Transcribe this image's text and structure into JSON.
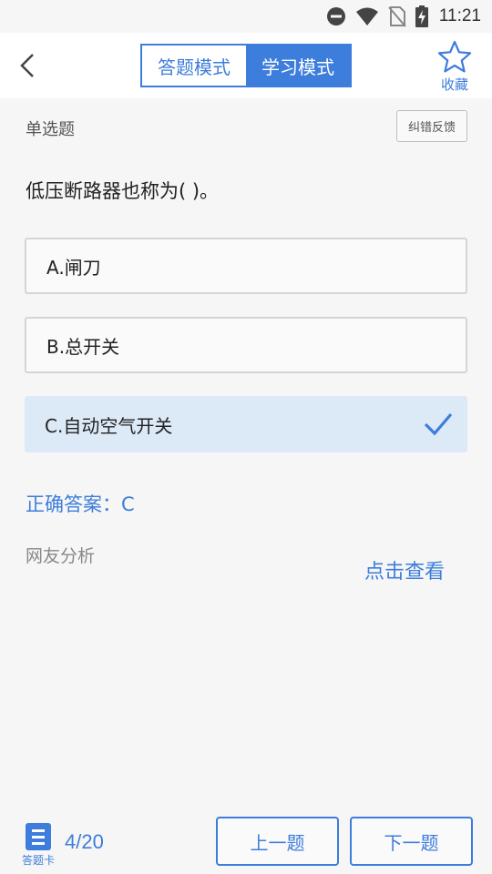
{
  "status_bar": {
    "time": "11:21",
    "icons": [
      "do-not-disturb-icon",
      "wifi-icon",
      "no-sim-icon",
      "battery-charging-icon"
    ]
  },
  "header": {
    "modes": [
      "答题模式",
      "学习模式"
    ],
    "active_mode": "学习模式",
    "favorite_label": "收藏",
    "accent_color": "#3d7ddb"
  },
  "question": {
    "type": "单选题",
    "report_label": "纠错反馈",
    "text": "低压断路器也称为( )。",
    "options": [
      {
        "label": "A.闸刀",
        "selected": false
      },
      {
        "label": "B.总开关",
        "selected": false
      },
      {
        "label": "C.自动空气开关",
        "selected": true
      }
    ],
    "correct_answer": "正确答案：C",
    "analysis_label": "网友分析",
    "view_label": "点击查看"
  },
  "footer": {
    "card_label": "答题卡",
    "progress": "4/20",
    "prev_label": "上一题",
    "next_label": "下一题"
  }
}
